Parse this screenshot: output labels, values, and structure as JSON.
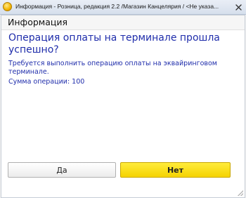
{
  "window": {
    "title": "Информация - Розница, редакция 2.2 /Магазин Канцелярия / <Не указа... (1С:Предприятие)",
    "close_glyph": "✕",
    "app_icon": "1c-enterprise-icon"
  },
  "form": {
    "title": "Информация",
    "question": "Операция оплаты на терминале прошла успешно?",
    "message": "Требуется выполнить операцию оплаты на эквайринговом терминале.",
    "amount_text": "Сумма операции: 100"
  },
  "buttons": {
    "yes_label": "Да",
    "no_label": "Нет"
  },
  "colors": {
    "text_accent": "#1f2dab",
    "default_button": "#f5d300"
  }
}
